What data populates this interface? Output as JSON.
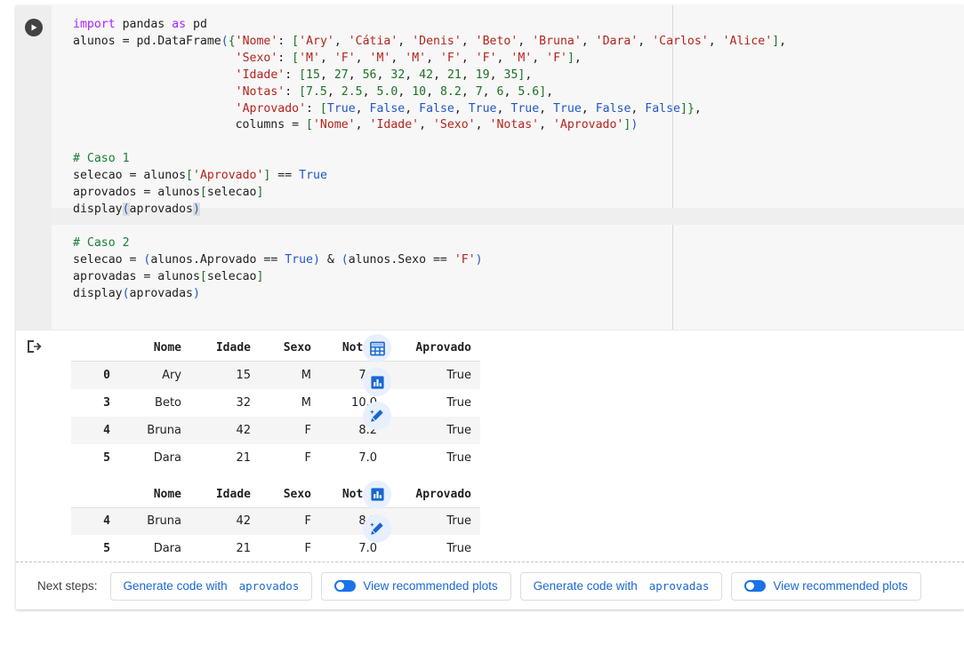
{
  "cell": {
    "run_button": "run-cell",
    "output_marker": "output-arrow"
  },
  "code": {
    "lines": [
      "import pandas as pd",
      "alunos = pd.DataFrame({'Nome': ['Ary', 'Cátia', 'Denis', 'Beto', 'Bruna', 'Dara', 'Carlos', 'Alice'],",
      "                       'Sexo': ['M', 'F', 'M', 'M', 'F', 'F', 'M', 'F'],",
      "                       'Idade': [15, 27, 56, 32, 42, 21, 19, 35],",
      "                       'Notas': [7.5, 2.5, 5.0, 10, 8.2, 7, 6, 5.6],",
      "                       'Aprovado': [True, False, False, True, True, True, False, False]},",
      "                       columns = ['Nome', 'Idade', 'Sexo', 'Notas', 'Aprovado'])",
      "",
      "# Caso 1",
      "selecao = alunos['Aprovado'] == True",
      "aprovados = alunos[selecao]",
      "display(aprovados)",
      "",
      "# Caso 2",
      "selecao = (alunos.Aprovado == True) & (alunos.Sexo == 'F')",
      "aprovadas = alunos[selecao]",
      "display(aprovadas)"
    ]
  },
  "tables": [
    {
      "name": "aprovados",
      "columns": [
        "Nome",
        "Idade",
        "Sexo",
        "Notas",
        "Aprovado"
      ],
      "rows": [
        {
          "index": "0",
          "Nome": "Ary",
          "Idade": "15",
          "Sexo": "M",
          "Notas": "7.5",
          "Aprovado": "True"
        },
        {
          "index": "3",
          "Nome": "Beto",
          "Idade": "32",
          "Sexo": "M",
          "Notas": "10.0",
          "Aprovado": "True"
        },
        {
          "index": "4",
          "Nome": "Bruna",
          "Idade": "42",
          "Sexo": "F",
          "Notas": "8.2",
          "Aprovado": "True"
        },
        {
          "index": "5",
          "Nome": "Dara",
          "Idade": "21",
          "Sexo": "F",
          "Notas": "7.0",
          "Aprovado": "True"
        }
      ],
      "icons": [
        "table-view-icon",
        "bar-chart-icon",
        "magic-edit-icon"
      ]
    },
    {
      "name": "aprovadas",
      "columns": [
        "Nome",
        "Idade",
        "Sexo",
        "Notas",
        "Aprovado"
      ],
      "rows": [
        {
          "index": "4",
          "Nome": "Bruna",
          "Idade": "42",
          "Sexo": "F",
          "Notas": "8.2",
          "Aprovado": "True"
        },
        {
          "index": "5",
          "Nome": "Dara",
          "Idade": "21",
          "Sexo": "F",
          "Notas": "7.0",
          "Aprovado": "True"
        }
      ],
      "icons": [
        "bar-chart-icon",
        "magic-edit-icon"
      ]
    }
  ],
  "next_steps": {
    "label": "Next steps:",
    "actions": [
      {
        "prefix": "Generate code with",
        "variable": "aprovados"
      },
      {
        "toggle": true,
        "label": "View recommended plots"
      },
      {
        "prefix": "Generate code with",
        "variable": "aprovadas"
      },
      {
        "toggle": true,
        "label": "View recommended plots"
      }
    ]
  },
  "colors": {
    "accent": "#1967d2",
    "icon_bg": "#e8f0fe",
    "code_bg": "#f7f7f7",
    "gutter_bg": "#eeeeee"
  }
}
